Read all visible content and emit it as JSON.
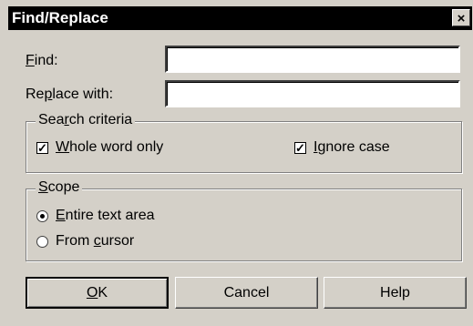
{
  "dialog": {
    "title": "Find/Replace",
    "close_glyph": "×"
  },
  "fields": {
    "find": {
      "label_pre": "",
      "label_key": "F",
      "label_post": "ind:",
      "value": ""
    },
    "replace": {
      "label_pre": "Re",
      "label_key": "p",
      "label_post": "lace with:",
      "value": ""
    }
  },
  "search_criteria": {
    "title_pre": "Sea",
    "title_key": "r",
    "title_post": "ch criteria",
    "whole_word": {
      "key": "W",
      "rest": "hole word only",
      "checked": "☑"
    },
    "ignore_case": {
      "key": "I",
      "rest": "gnore case",
      "checked": "☑"
    }
  },
  "scope": {
    "title_key": "S",
    "title_post": "cope",
    "entire": {
      "key": "E",
      "rest": "ntire text area",
      "selected": true
    },
    "cursor": {
      "pre": "From ",
      "key": "c",
      "rest": "ursor",
      "selected": false
    }
  },
  "buttons": {
    "ok": {
      "key": "O",
      "rest": "K"
    },
    "cancel": "Cancel",
    "help": "Help"
  }
}
